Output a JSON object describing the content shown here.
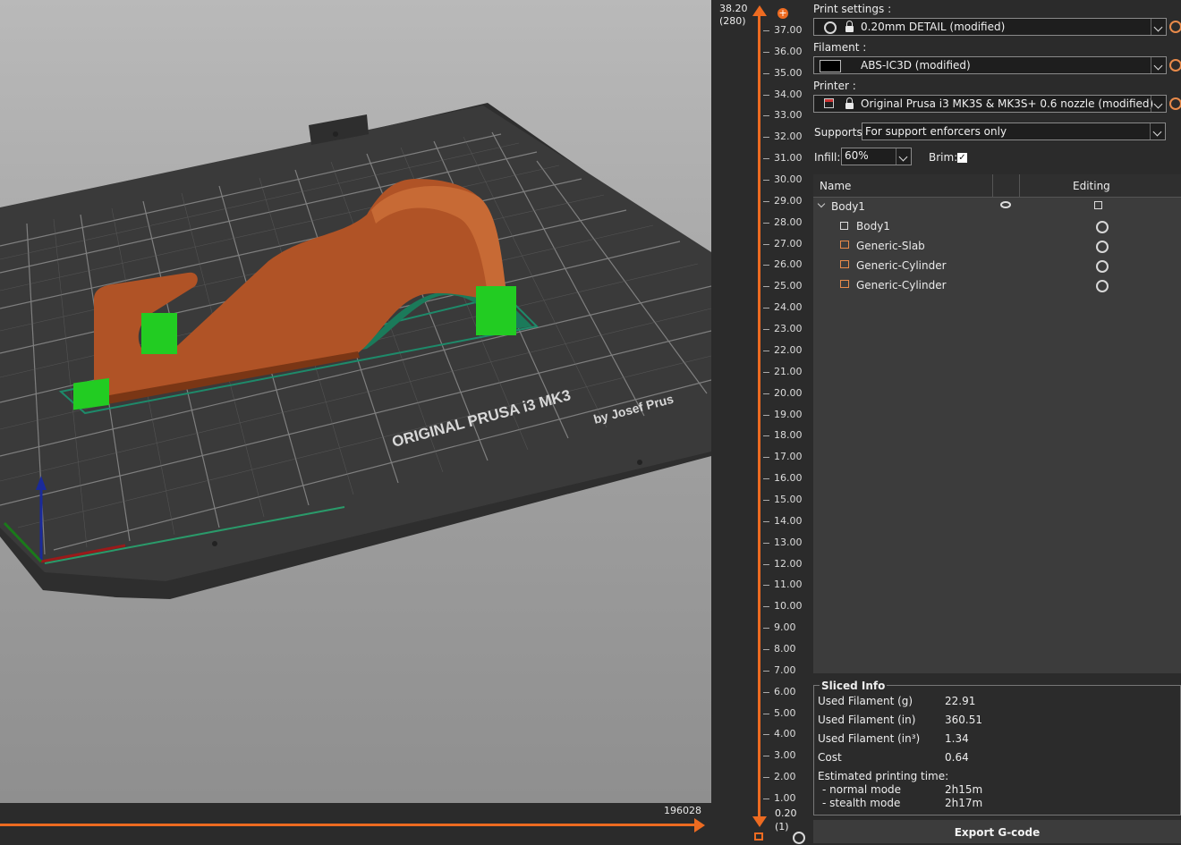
{
  "colors": {
    "accent": "#ed6b21",
    "model": "#b05326",
    "support": "#22cc22",
    "brim": "#1e8a6a"
  },
  "viewport": {
    "bed_brand_text": "ORIGINAL PRUSA i3  MK3",
    "bed_brand_sub": "by Josef Prus",
    "move_count": "196028"
  },
  "layer_slider": {
    "top_height": "38.20",
    "top_layer": "(280)",
    "bottom_height": "0.20",
    "bottom_layer": "(1)",
    "ticks": [
      "37.00",
      "36.00",
      "35.00",
      "34.00",
      "33.00",
      "32.00",
      "31.00",
      "30.00",
      "29.00",
      "28.00",
      "27.00",
      "26.00",
      "25.00",
      "24.00",
      "23.00",
      "22.00",
      "21.00",
      "20.00",
      "19.00",
      "18.00",
      "17.00",
      "16.00",
      "15.00",
      "14.00",
      "13.00",
      "12.00",
      "11.00",
      "10.00",
      "9.00",
      "8.00",
      "7.00",
      "6.00",
      "5.00",
      "4.00",
      "3.00",
      "2.00",
      "1.00"
    ]
  },
  "sidebar": {
    "print_settings_label": "Print settings :",
    "print_settings_value": "0.20mm DETAIL (modified)",
    "filament_label": "Filament :",
    "filament_value": "ABS-IC3D (modified)",
    "printer_label": "Printer :",
    "printer_value": "Original Prusa i3 MK3S & MK3S+ 0.6 nozzle (modified)",
    "supports_label": "Supports:",
    "supports_value": "For support enforcers only",
    "infill_label": "Infill:",
    "infill_value": "60%",
    "brim_label": "Brim:",
    "brim_checked": true
  },
  "object_list": {
    "col_name": "Name",
    "col_editing": "Editing",
    "items": [
      {
        "label": "Body1",
        "type": "object",
        "icon": "eye-icon"
      },
      {
        "label": "Body1",
        "type": "part-add"
      },
      {
        "label": "Generic-Slab",
        "type": "modifier"
      },
      {
        "label": "Generic-Cylinder",
        "type": "modifier"
      },
      {
        "label": "Generic-Cylinder",
        "type": "modifier"
      }
    ]
  },
  "sliced_info": {
    "title": "Sliced Info",
    "rows": [
      {
        "k": "Used Filament (g)",
        "v": "22.91"
      },
      {
        "k": "Used Filament (in)",
        "v": "360.51"
      },
      {
        "k": "Used Filament (in³)",
        "v": "1.34"
      },
      {
        "k": "Cost",
        "v": "0.64"
      }
    ],
    "time_label": "Estimated printing time:",
    "normal_label": "- normal mode",
    "normal_value": "2h15m",
    "stealth_label": "- stealth mode",
    "stealth_value": "2h17m"
  },
  "export_label": "Export G-code"
}
